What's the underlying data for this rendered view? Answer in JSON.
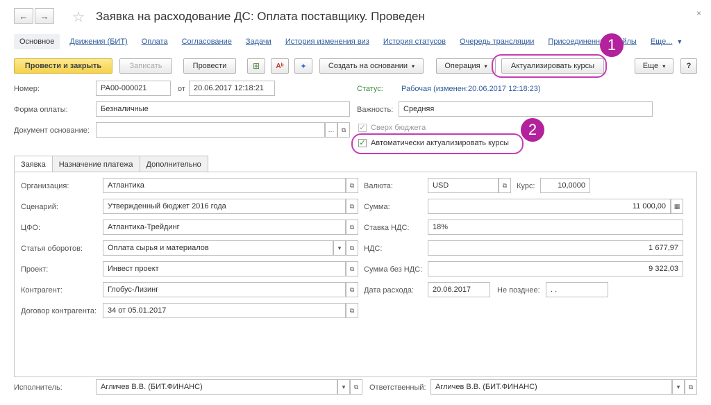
{
  "window": {
    "title": "Заявка на расходование ДС: Оплата поставщику. Проведен",
    "back_glyph": "←",
    "forward_glyph": "→",
    "star_glyph": "☆",
    "close_glyph": "×"
  },
  "nav_tabs": [
    "Основное",
    "Движения (БИТ)",
    "Оплата",
    "Согласование",
    "Задачи",
    "История изменения виз",
    "История статусов",
    "Очередь трансляции",
    "Присоединенные файлы",
    "Еще..."
  ],
  "toolbar": {
    "post_close": "Провести и закрыть",
    "write": "Записать",
    "post": "Провести",
    "create_based": "Создать на основании",
    "operation": "Операция",
    "update_rates": "Актуализировать курсы",
    "more": "Еще",
    "help": "?"
  },
  "header": {
    "number_label": "Номер:",
    "number": "РА00-000021",
    "from_label": "от",
    "date": "20.06.2017 12:18:21",
    "status_label": "Статус:",
    "status_value": "Рабочая (изменен:20.06.2017 12:18:23)",
    "payment_form_label": "Форма оплаты:",
    "payment_form": "Безналичные",
    "importance_label": "Важность:",
    "importance": "Средняя",
    "basis_doc_label": "Документ основание:",
    "basis_doc": "",
    "over_budget_label": "Сверх бюджета",
    "over_budget_checked": true,
    "auto_update_label": "Автоматически актуализировать курсы",
    "auto_update_checked": true
  },
  "tabs": [
    "Заявка",
    "Назначение платежа",
    "Дополнительно"
  ],
  "form": {
    "org_label": "Организация:",
    "org": "Атлантика",
    "scenario_label": "Сценарий:",
    "scenario": "Утвержденный бюджет 2016  года",
    "cfo_label": "ЦФО:",
    "cfo": "Атлантика-Трейдинг",
    "article_label": "Статья оборотов:",
    "article": "Оплата сырья и материалов",
    "project_label": "Проект:",
    "project": "Инвест проект",
    "counterparty_label": "Контрагент:",
    "counterparty": "Глобус-Лизинг",
    "contract_label": "Договор контрагента:",
    "contract": "34 от 05.01.2017",
    "currency_label": "Валюта:",
    "currency": "USD",
    "rate_label": "Курс:",
    "rate": "10,0000",
    "sum_label": "Сумма:",
    "sum": "11 000,00",
    "vat_rate_label": "Ставка НДС:",
    "vat_rate": "18%",
    "vat_label": "НДС:",
    "vat": "1 677,97",
    "sum_no_vat_label": "Сумма без НДС:",
    "sum_no_vat": "9 322,03",
    "expense_date_label": "Дата расхода:",
    "expense_date": "20.06.2017",
    "not_later_label": "Не позднее:",
    "not_later": " .  ."
  },
  "footer": {
    "executor_label": "Исполнитель:",
    "executor": "Агличев В.В. (БИТ.ФИНАНС)",
    "responsible_label": "Ответственный:",
    "responsible": "Агличев В.В. (БИТ.ФИНАНС)"
  },
  "annotations": [
    "1",
    "2"
  ],
  "colors": {
    "highlight": "#c73bb5",
    "badge": "#b3219d",
    "primary_button": "#f4d24a",
    "link": "#2f5d9e",
    "status_label": "#3d8a3d"
  }
}
